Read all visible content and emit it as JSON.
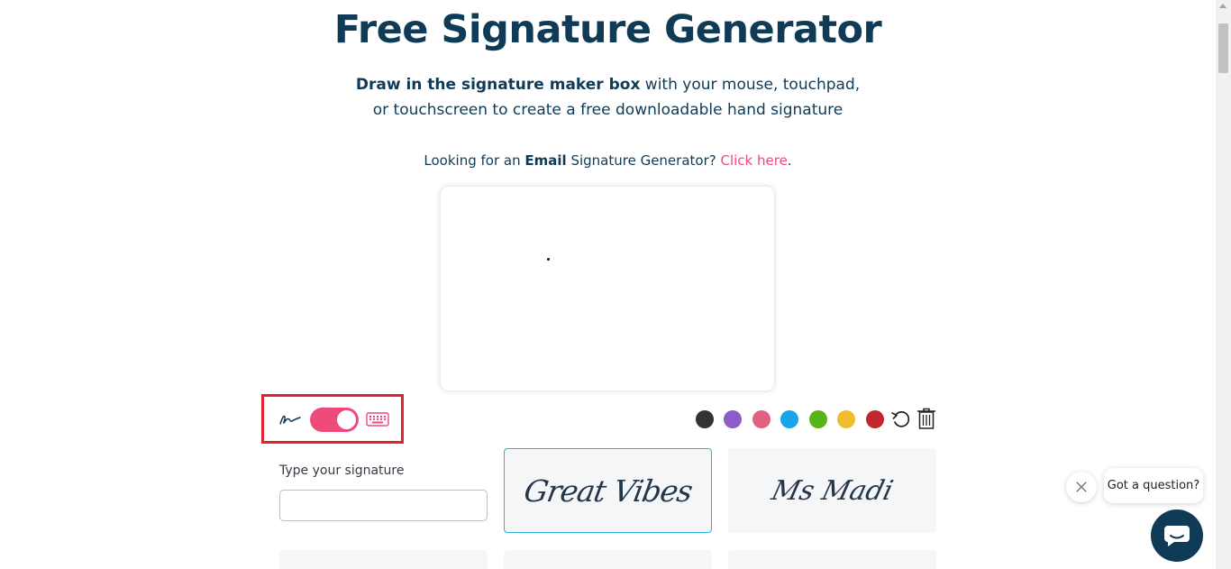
{
  "header": {
    "title": "Free Signature Generator",
    "subtitle_bold": "Draw in the signature maker box",
    "subtitle_rest_line1": " with your mouse, touchpad,",
    "subtitle_line2": "or touchscreen to create a free downloadable hand signature"
  },
  "email_prompt": {
    "prefix": "Looking for an ",
    "bold": "Email",
    "middle": " Signature Generator? ",
    "link": "Click here",
    "suffix": "."
  },
  "toolbar": {
    "mode_draw_icon": "signature-pen-icon",
    "mode_type_icon": "keyboard-icon",
    "toggle_state": "on",
    "colors": [
      "#333333",
      "#8e5cc7",
      "#e2607f",
      "#1aa3e8",
      "#57b51a",
      "#f1bd2e",
      "#c0262d"
    ],
    "undo_icon": "undo-icon",
    "clear_icon": "trash-icon"
  },
  "type_signature": {
    "label": "Type your signature",
    "value": "",
    "placeholder": ""
  },
  "font_cards": [
    {
      "name": "Great Vibes",
      "sample": "Great Vibes",
      "selected": true
    },
    {
      "name": "Ms Madi",
      "sample": "Ms Madi",
      "selected": false
    }
  ],
  "chat": {
    "prompt": "Got a question?",
    "close_icon": "close-icon",
    "chat_icon": "chat-icon"
  }
}
